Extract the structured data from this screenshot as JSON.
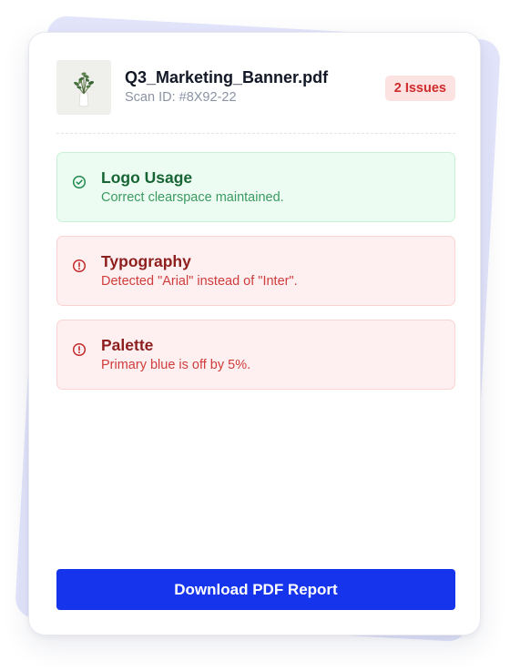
{
  "file": {
    "name": "Q3_Marketing_Banner.pdf",
    "scan_id": "Scan ID: #8X92-22",
    "issues_badge": "2 Issues",
    "thumbnail_icon": "plant-thumbnail-image"
  },
  "checks": [
    {
      "status": "pass",
      "icon": "check-circle-icon",
      "title": "Logo Usage",
      "description": "Correct clearspace maintained."
    },
    {
      "status": "fail",
      "icon": "alert-circle-icon",
      "title": "Typography",
      "description": "Detected \"Arial\" instead of \"Inter\"."
    },
    {
      "status": "fail",
      "icon": "alert-circle-icon",
      "title": "Palette",
      "description": "Primary blue is off by 5%."
    }
  ],
  "actions": {
    "download_label": "Download PDF Report"
  },
  "colors": {
    "accent": "#1534eb",
    "pass": "#176534",
    "fail": "#8e1f1f",
    "badge_text": "#cf2b2b",
    "badge_bg": "#fde2e2"
  }
}
